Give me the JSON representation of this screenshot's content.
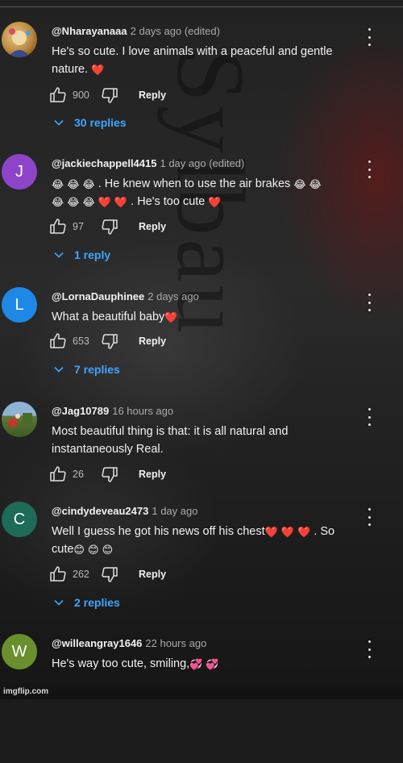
{
  "comments": [
    {
      "author": "@Nharayanaaa",
      "time": "2 days ago (edited)",
      "text_html": "He's so cute. I love animals with a peaceful and gentle nature. <span class=\"emoji\">❤️</span>",
      "likes": "900",
      "reply_label": "Reply",
      "replies_label": "30 replies",
      "avatar_letter": "",
      "avatar_color": "#c9a86a"
    },
    {
      "author": "@jackiechappell4415",
      "time": "1 day ago (edited)",
      "text_html": "<span class=\"emoji\">😂</span> <span class=\"emoji\">😂</span> <span class=\"emoji\">😂</span> . He knew when to use the air brakes <span class=\"emoji\">😂</span> <span class=\"emoji\">😂</span><br><span class=\"emoji\">😂</span> <span class=\"emoji\">😂</span> <span class=\"emoji\">😂</span> <span class=\"emoji\">❤️</span> <span class=\"emoji\">❤️</span> . He's too cute <span class=\"emoji\">❤️</span>",
      "likes": "97",
      "reply_label": "Reply",
      "replies_label": "1 reply",
      "avatar_letter": "J",
      "avatar_color": "#8e44c9"
    },
    {
      "author": "@LornaDauphinee",
      "time": "2 days ago",
      "text_html": "What a beautiful baby<span class=\"emoji\">❤️</span>",
      "likes": "653",
      "reply_label": "Reply",
      "replies_label": "7 replies",
      "avatar_letter": "L",
      "avatar_color": "#1e88e5"
    },
    {
      "author": "@Jag10789",
      "time": "16 hours ago",
      "text_html": "Most beautiful thing is that: it is all natural and instantaneously Real.",
      "likes": "26",
      "reply_label": "Reply",
      "replies_label": "",
      "avatar_letter": "",
      "avatar_color": "#5d7a3a"
    },
    {
      "author": "@cindydeveau2473",
      "time": "1 day ago",
      "text_html": "Well I guess he got his news off his chest<span class=\"emoji\">❤️</span> <span class=\"emoji\">❤️</span> <span class=\"emoji\">❤️</span> . So cute<span class=\"emoji\">😊</span> <span class=\"emoji\">😊</span> <span class=\"emoji\">😊</span>",
      "likes": "262",
      "reply_label": "Reply",
      "replies_label": "2 replies",
      "avatar_letter": "C",
      "avatar_color": "#1e6b57"
    },
    {
      "author": "@willeangray1646",
      "time": "22 hours ago",
      "text_html": "He's way too cute, smiling,<span class=\"emoji\">💞</span> <span class=\"emoji\">💞</span>",
      "likes": "",
      "reply_label": "",
      "replies_label": "",
      "avatar_letter": "W",
      "avatar_color": "#6a8f2e"
    }
  ],
  "background_watermark": "Sylbau",
  "watermark": "imgflip.com",
  "colors": {
    "link_blue": "#3ea6ff",
    "meta_gray": "#aaaaaa"
  }
}
